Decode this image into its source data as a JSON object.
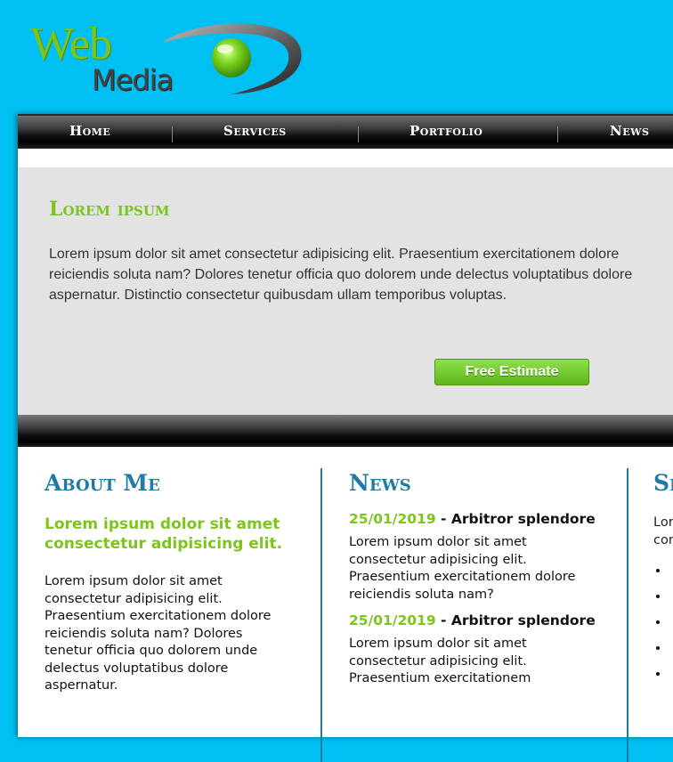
{
  "logo": {
    "word1": "Web",
    "word2": "Media"
  },
  "nav": {
    "items": [
      "Home",
      "Services",
      "Portfolio",
      "News"
    ]
  },
  "hero": {
    "title": "Lorem ipsum",
    "text": "Lorem ipsum dolor sit amet consectetur adipisicing elit. Praesentium exercitationem dolore reiciendis soluta nam? Dolores tenetur officia quo dolorem unde delectus voluptatibus dolore aspernatur. Distinctio consectetur quibusdam ullam temporibus voluptas.",
    "button": "Free Estimate"
  },
  "about": {
    "title": "About Me",
    "lead": "Lorem ipsum dolor sit amet consectetur adipisicing elit.",
    "body": "Lorem ipsum dolor sit amet consectetur adipisicing elit. Praesentium exercitationem dolore reiciendis soluta nam? Dolores tenetur officia quo dolorem unde delectus voluptatibus dolore aspernatur."
  },
  "news": {
    "title": "News",
    "entries": [
      {
        "date": "25/01/2019",
        "headline": "Arbitror splendore",
        "body": "Lorem ipsum dolor sit amet consectetur adipisicing elit. Praesentium exercitationem dolore reiciendis soluta nam?"
      },
      {
        "date": "25/01/2019",
        "headline": "Arbitror splendore",
        "body": "Lorem ipsum dolor sit amet consectetur adipisicing elit. Praesentium exercitationem"
      }
    ]
  },
  "services": {
    "title": "Se",
    "intro_line1": "Lor",
    "intro_line2": "con",
    "items": [
      "",
      "",
      "",
      "",
      ""
    ]
  },
  "colors": {
    "background": "#00bff3",
    "accent_green": "#7cc61b",
    "heading_blue": "#217aa3"
  }
}
